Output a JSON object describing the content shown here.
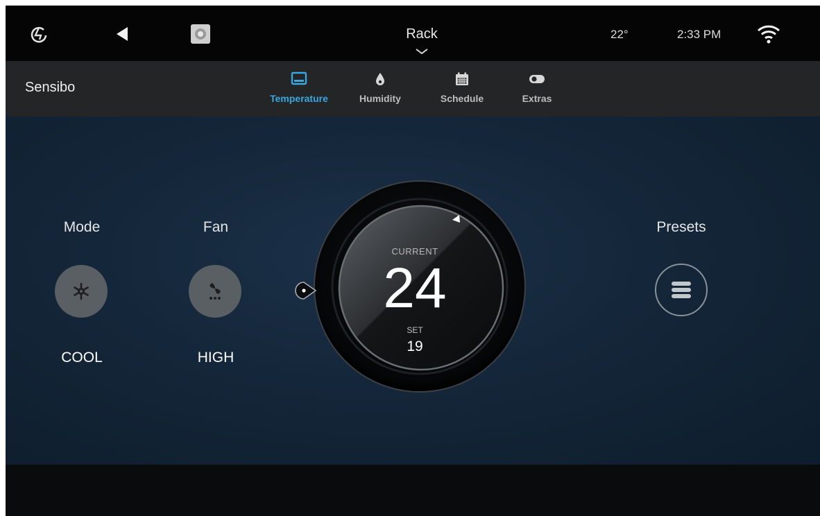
{
  "topbar": {
    "title": "Rack",
    "outside_temp": "22°",
    "time": "2:33 PM",
    "icons": [
      "home-logo-icon",
      "back-arrow-icon",
      "device-thumbnail-icon",
      "chevron-down-icon",
      "wifi-icon"
    ]
  },
  "subbar": {
    "device_name": "Sensibo",
    "tabs": [
      {
        "label": "Temperature",
        "icon": "thermometer-screen-icon",
        "active": true
      },
      {
        "label": "Humidity",
        "icon": "droplet-icon",
        "active": false
      },
      {
        "label": "Schedule",
        "icon": "calendar-icon",
        "active": false
      },
      {
        "label": "Extras",
        "icon": "toggle-icon",
        "active": false
      }
    ],
    "accent_color": "#3aa7e0"
  },
  "controls": {
    "mode": {
      "label": "Mode",
      "value": "COOL",
      "icon": "snowflake-icon"
    },
    "fan": {
      "label": "Fan",
      "value": "HIGH",
      "icon": "fan-icon"
    },
    "presets": {
      "label": "Presets",
      "icon": "menu-lines-icon"
    }
  },
  "dial": {
    "current_label": "CURRENT",
    "current_value": "24",
    "set_label": "SET",
    "set_value": "19"
  }
}
